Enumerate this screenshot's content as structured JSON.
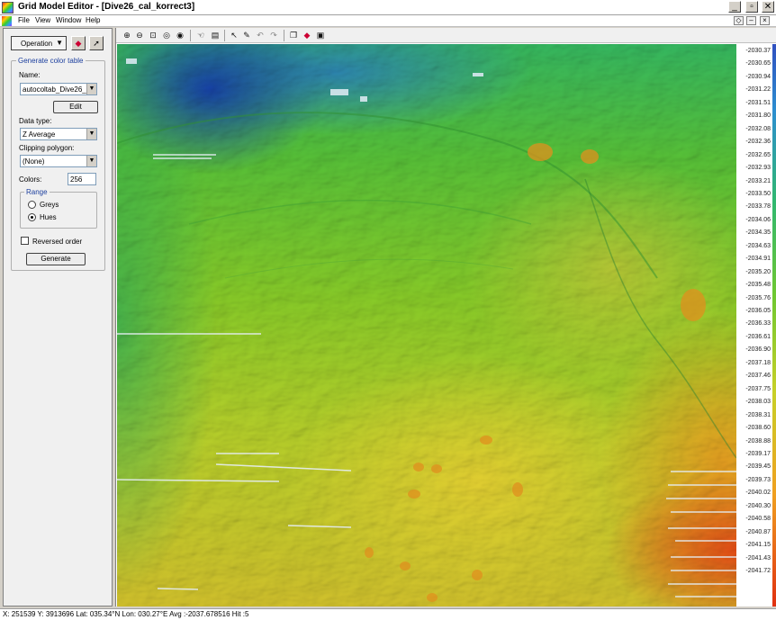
{
  "window": {
    "title": "Grid Model Editor - [Dive26_cal_korrect3]",
    "buttons": {
      "minimize": "_",
      "maximize": "▫",
      "close": "✕"
    }
  },
  "menu": {
    "items": [
      "File",
      "View",
      "Window",
      "Help"
    ]
  },
  "left_panel": {
    "operation_label": "Operation",
    "group_title": "Generate color table",
    "name_label": "Name:",
    "name_value": "autocoltab_Dive26_c",
    "edit_button": "Edit",
    "data_type_label": "Data type:",
    "data_type_value": "Z Average",
    "clipping_label": "Clipping polygon:",
    "clipping_value": "(None)",
    "colors_label": "Colors:",
    "colors_value": "256",
    "range_title": "Range",
    "range_options": [
      "Greys",
      "Hues"
    ],
    "range_selected": "Hues",
    "reversed_label": "Reversed order",
    "reversed_checked": false,
    "generate_button": "Generate"
  },
  "color_scale": {
    "labels": [
      "-2030.37",
      "-2030.65",
      "-2030.94",
      "-2031.22",
      "-2031.51",
      "-2031.80",
      "-2032.08",
      "-2032.36",
      "-2032.65",
      "-2032.93",
      "-2033.21",
      "-2033.50",
      "-2033.78",
      "-2034.06",
      "-2034.35",
      "-2034.63",
      "-2034.91",
      "-2035.20",
      "-2035.48",
      "-2035.76",
      "-2036.05",
      "-2036.33",
      "-2036.61",
      "-2036.90",
      "-2037.18",
      "-2037.46",
      "-2037.75",
      "-2038.03",
      "-2038.31",
      "-2038.60",
      "-2038.88",
      "-2039.17",
      "-2039.45",
      "-2039.73",
      "-2040.02",
      "-2040.30",
      "-2040.58",
      "-2040.87",
      "-2041.15",
      "-2041.43",
      "-2041.72"
    ],
    "colors": {
      "top": "#3050c0",
      "mid": "#70c830",
      "bottom": "#e03010"
    }
  },
  "status": {
    "text": "X: 251539  Y: 3913696  Lat: 035.34°N  Lon: 030.27°E  Avg :-2037.678516  Hit :5"
  }
}
